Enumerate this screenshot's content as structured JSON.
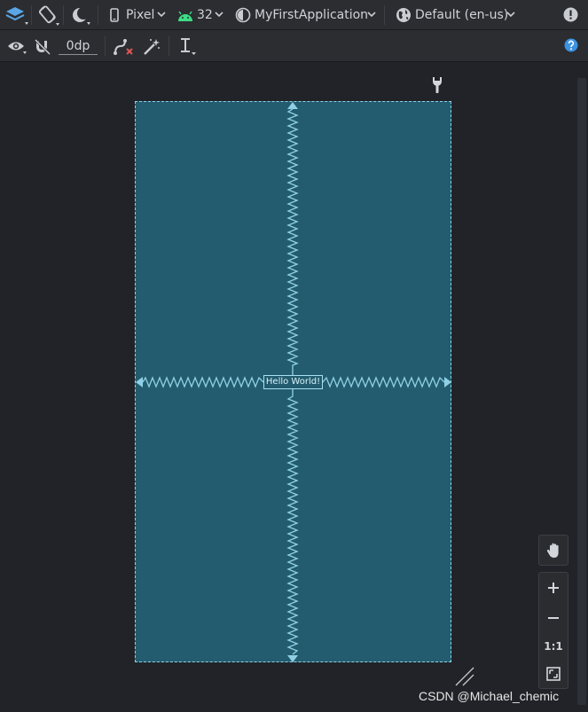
{
  "toolbar_top": {
    "device_label": "Pixel",
    "api_label": "32",
    "theme_label": "MyFirstApplication",
    "locale_label": "Default (en-us)"
  },
  "toolbar_second": {
    "margin_value": "0dp"
  },
  "canvas": {
    "hello_text": "Hello World!"
  },
  "zoom": {
    "reset_label": "1:1"
  },
  "watermark": "CSDN @Michael_chemic",
  "colors": {
    "screen_bg": "#235c6e",
    "constraint": "#8fd0e6",
    "android_green": "#3ddc84",
    "help_blue": "#3b93e0"
  }
}
